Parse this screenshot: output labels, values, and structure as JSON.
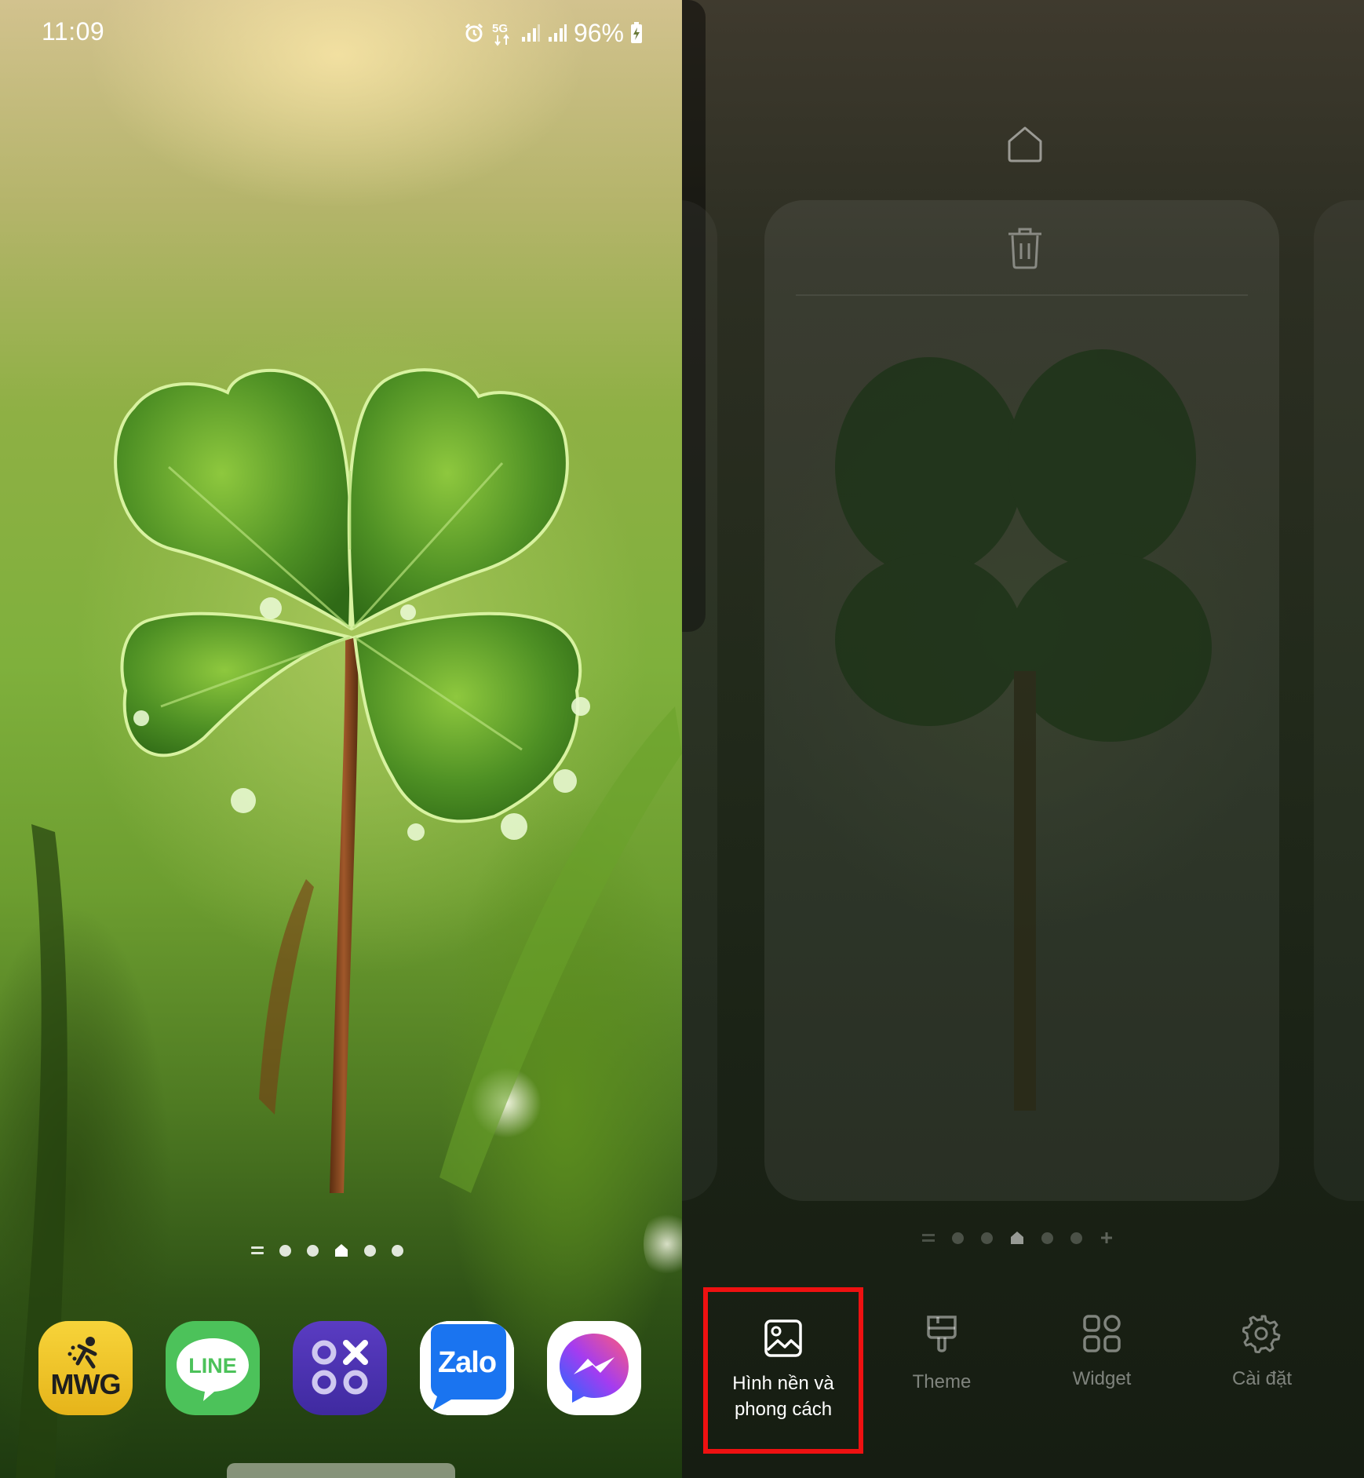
{
  "status_bar": {
    "time": "11:09",
    "battery": "96%",
    "icons": [
      "alarm-icon",
      "5g-icon",
      "signal-icon",
      "signal-icon",
      "battery-charging-icon"
    ]
  },
  "home_screen": {
    "page_indicator": {
      "pages": 5,
      "current_page": 4,
      "has_menu_lines": true
    },
    "dock_apps": [
      {
        "label": "MWG"
      },
      {
        "label": "LINE"
      },
      {
        "label": ""
      },
      {
        "label": "Zalo"
      },
      {
        "label": ""
      }
    ]
  },
  "edit_mode": {
    "page_indicator": {
      "pages": 5,
      "current_page": 3,
      "has_add": true
    },
    "menu": [
      {
        "label": "Hình nền và phong cách",
        "icon": "wallpaper-icon",
        "highlighted": true
      },
      {
        "label": "Theme",
        "icon": "paintbrush-icon"
      },
      {
        "label": "Widget",
        "icon": "widgets-icon"
      },
      {
        "label": "Cài đặt",
        "icon": "gear-icon"
      }
    ],
    "highlight_color": "#ee1111"
  }
}
